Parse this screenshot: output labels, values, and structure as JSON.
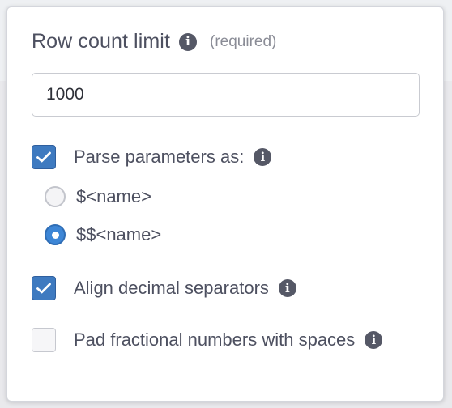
{
  "panel": {
    "title": "Row count limit",
    "required_text": "(required)",
    "row_limit_value": "1000"
  },
  "options": {
    "parse_parameters": {
      "label": "Parse parameters as:",
      "checked": true,
      "choices": [
        {
          "label": "$<name>",
          "selected": false
        },
        {
          "label": "$$<name>",
          "selected": true
        }
      ]
    },
    "align_decimal": {
      "label": "Align decimal separators",
      "checked": true
    },
    "pad_fractional": {
      "label": "Pad fractional numbers with spaces",
      "checked": false
    }
  },
  "icons": {
    "info": "info-icon",
    "check": "checkmark-icon"
  },
  "colors": {
    "accent": "#3e7ac0",
    "radio_selected": "#3d86d6",
    "text": "#4d5060",
    "muted": "#8a8c96",
    "info_icon": "#555866"
  }
}
